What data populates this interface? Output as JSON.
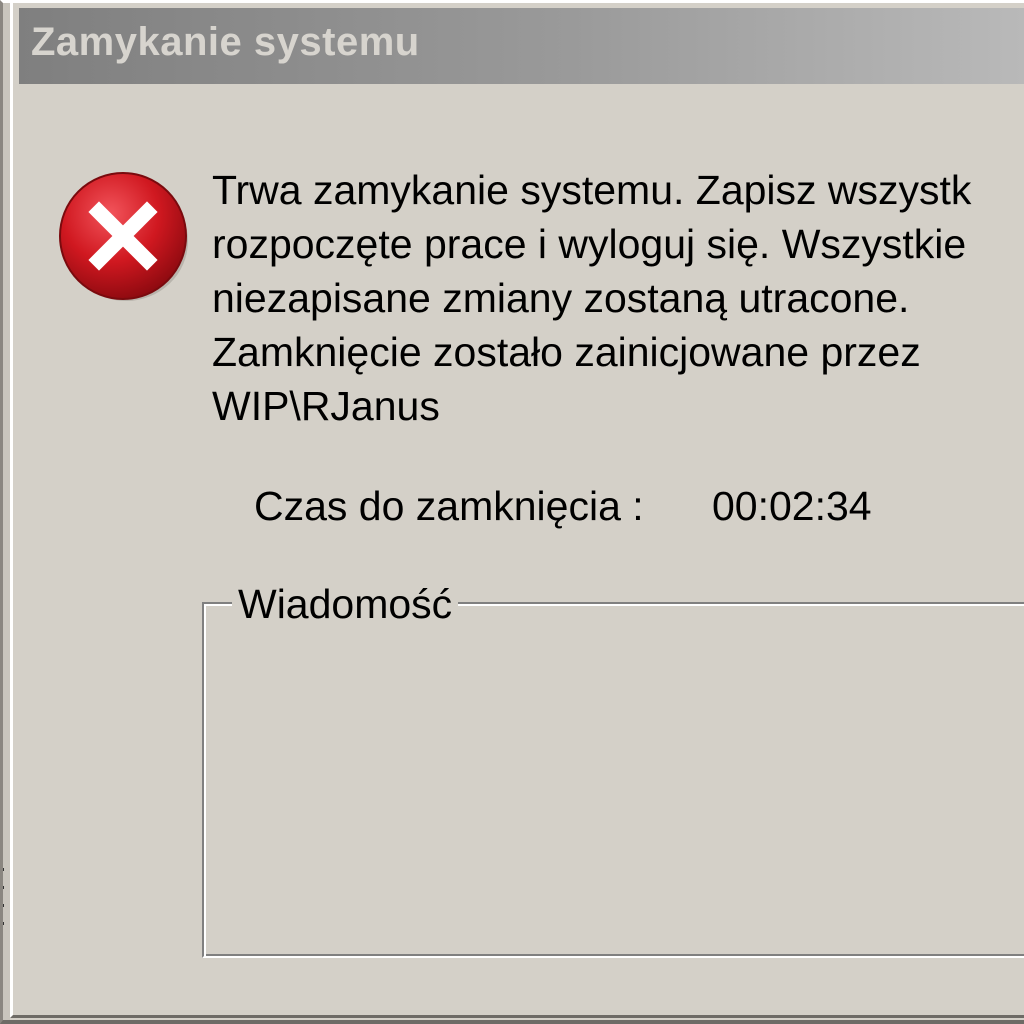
{
  "window": {
    "title": "Zamykanie systemu"
  },
  "dialog": {
    "icon": "error-icon",
    "message_lines": [
      "Trwa zamykanie systemu. Zapisz wszystk",
      "rozpoczęte prace i wyloguj się. Wszystkie",
      "niezapisane zmiany zostaną utracone.",
      "Zamknięcie zostało zainicjowane przez",
      "WIP\\RJanus"
    ],
    "countdown_label": "Czas do zamknięcia :",
    "countdown_value": "00:02:34",
    "message_group_label": "Wiadomość",
    "message_text": ""
  },
  "colors": {
    "dialog_background": "#d4d0c8",
    "titlebar_inactive_start": "#7f7f7f",
    "titlebar_inactive_end": "#b9b9b9",
    "title_text": "#d7d4ce",
    "error_red": "#c8141b"
  }
}
